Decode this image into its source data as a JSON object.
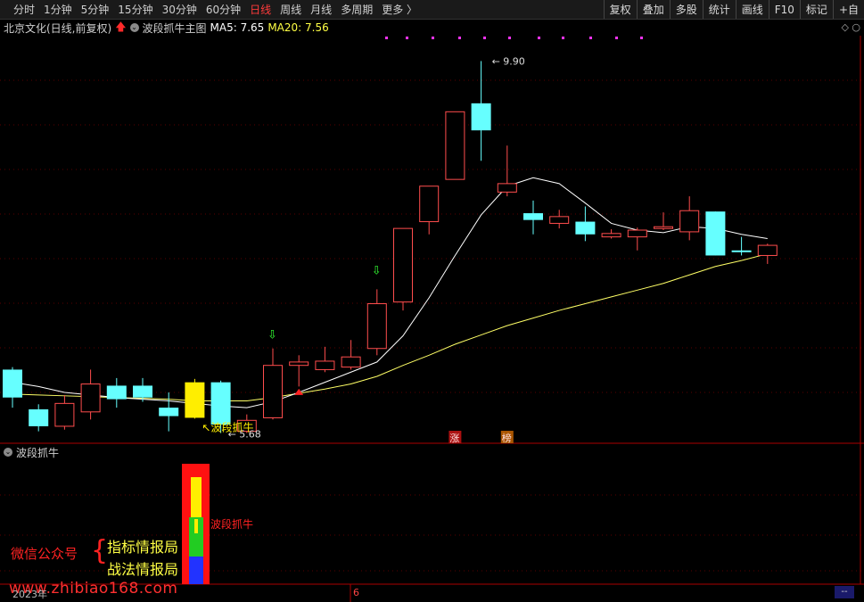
{
  "toolbar": {
    "periods": [
      "分时",
      "1分钟",
      "5分钟",
      "15分钟",
      "30分钟",
      "60分钟",
      "日线",
      "周线",
      "月线",
      "多周期",
      "更多 〉"
    ],
    "active_period": "日线",
    "buttons": [
      "复权",
      "叠加",
      "多股",
      "统计",
      "画线",
      "F10",
      "标记",
      "+自"
    ]
  },
  "info": {
    "stock_name": "北京文化(日线,前复权)",
    "indicator_name": "波段抓牛主图",
    "ma5": "MA5: 7.65",
    "ma20": "MA20: 7.56"
  },
  "colors": {
    "up": "#ff4d4d",
    "down": "#66ffff",
    "signal": "#ffee00",
    "ma5": "#ffffff",
    "ma20": "#ffff66",
    "grid": "#5a0000"
  },
  "chart_data": {
    "type": "candlestick",
    "title": "北京文化(日线,前复权)",
    "price_range": [
      5.4,
      10.2
    ],
    "candles": [
      {
        "open": 6.25,
        "close": 5.92,
        "high": 6.28,
        "low": 5.8,
        "kind": "down"
      },
      {
        "open": 5.78,
        "close": 5.58,
        "high": 5.84,
        "low": 5.52,
        "kind": "down"
      },
      {
        "open": 5.58,
        "close": 5.85,
        "high": 5.95,
        "low": 5.54,
        "kind": "up"
      },
      {
        "open": 5.75,
        "close": 6.08,
        "high": 6.25,
        "low": 5.66,
        "kind": "up"
      },
      {
        "open": 6.06,
        "close": 5.9,
        "high": 6.15,
        "low": 5.8,
        "kind": "down"
      },
      {
        "open": 6.06,
        "close": 5.92,
        "high": 6.15,
        "low": 5.87,
        "kind": "down"
      },
      {
        "open": 5.8,
        "close": 5.7,
        "high": 5.98,
        "low": 5.52,
        "kind": "down"
      },
      {
        "open": 6.1,
        "close": 5.68,
        "high": 6.14,
        "low": 5.67,
        "kind": "signal"
      },
      {
        "open": 6.1,
        "close": 5.6,
        "high": 6.12,
        "low": 5.5,
        "kind": "down"
      },
      {
        "open": 5.52,
        "close": 5.65,
        "high": 5.72,
        "low": 5.5,
        "kind": "up"
      },
      {
        "open": 5.68,
        "close": 6.3,
        "high": 6.5,
        "low": 5.66,
        "kind": "up"
      },
      {
        "open": 6.3,
        "close": 6.34,
        "high": 6.42,
        "low": 6.05,
        "kind": "up"
      },
      {
        "open": 6.25,
        "close": 6.35,
        "high": 6.52,
        "low": 6.22,
        "kind": "up"
      },
      {
        "open": 6.28,
        "close": 6.4,
        "high": 6.6,
        "low": 6.25,
        "kind": "up"
      },
      {
        "open": 6.5,
        "close": 7.03,
        "high": 7.2,
        "low": 6.42,
        "kind": "up"
      },
      {
        "open": 7.05,
        "close": 7.92,
        "high": 7.92,
        "low": 6.95,
        "kind": "up"
      },
      {
        "open": 8.0,
        "close": 8.42,
        "high": 8.42,
        "low": 7.85,
        "kind": "up"
      },
      {
        "open": 8.5,
        "close": 9.3,
        "high": 9.3,
        "low": 8.5,
        "kind": "up"
      },
      {
        "open": 9.4,
        "close": 9.08,
        "high": 9.9,
        "low": 8.72,
        "kind": "down"
      },
      {
        "open": 8.35,
        "close": 8.45,
        "high": 8.9,
        "low": 8.3,
        "kind": "up"
      },
      {
        "open": 8.02,
        "close": 8.1,
        "high": 8.25,
        "low": 7.85,
        "kind": "down"
      },
      {
        "open": 7.98,
        "close": 8.06,
        "high": 8.14,
        "low": 7.92,
        "kind": "up"
      },
      {
        "open": 8.0,
        "close": 7.85,
        "high": 8.18,
        "low": 7.77,
        "kind": "down"
      },
      {
        "open": 7.82,
        "close": 7.86,
        "high": 7.91,
        "low": 7.8,
        "kind": "up"
      },
      {
        "open": 7.82,
        "close": 7.9,
        "high": 7.93,
        "low": 7.66,
        "kind": "up"
      },
      {
        "open": 7.92,
        "close": 7.94,
        "high": 8.11,
        "low": 7.9,
        "kind": "up"
      },
      {
        "open": 7.88,
        "close": 8.13,
        "high": 8.3,
        "low": 7.78,
        "kind": "up"
      },
      {
        "open": 8.12,
        "close": 7.6,
        "high": 8.12,
        "low": 7.6,
        "kind": "down"
      },
      {
        "open": 7.64,
        "close": 7.66,
        "high": 7.82,
        "low": 7.6,
        "kind": "down"
      },
      {
        "open": 7.6,
        "close": 7.72,
        "high": 7.74,
        "low": 7.5,
        "kind": "up"
      }
    ],
    "ma5": [
      6.1,
      6.05,
      5.98,
      5.95,
      5.92,
      5.9,
      5.88,
      5.85,
      5.82,
      5.8,
      5.87,
      5.98,
      6.1,
      6.22,
      6.34,
      6.65,
      7.1,
      7.6,
      8.08,
      8.42,
      8.52,
      8.45,
      8.22,
      7.98,
      7.9,
      7.87,
      7.94,
      7.92,
      7.85,
      7.8
    ],
    "ma20": [
      5.96,
      5.95,
      5.94,
      5.93,
      5.92,
      5.91,
      5.9,
      5.88,
      5.88,
      5.88,
      5.92,
      5.97,
      6.02,
      6.08,
      6.17,
      6.3,
      6.42,
      6.55,
      6.66,
      6.77,
      6.86,
      6.95,
      7.03,
      7.11,
      7.19,
      7.27,
      7.37,
      7.47,
      7.54,
      7.62
    ],
    "annotations": {
      "high_label": "9.90",
      "low_label": "5.68",
      "signal_label": "波段抓牛",
      "tag_zhang": "涨",
      "tag_bang": "榜"
    }
  },
  "indicator_panel": {
    "name": "波段抓牛",
    "label": "波段抓牛"
  },
  "watermark": {
    "left": "微信公众号",
    "right_1": "指标情报局",
    "right_2": "战法情报局",
    "url": "www.zhibiao168.com"
  },
  "dates": {
    "left": "2023年",
    "mid": "6"
  },
  "corner_box": "--"
}
